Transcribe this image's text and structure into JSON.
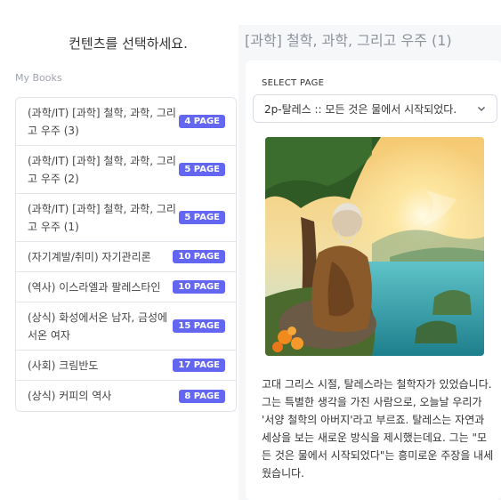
{
  "left": {
    "title": "컨텐츠를 선택하세요.",
    "section_label": "My Books",
    "books": [
      {
        "title": "(과학/IT) [과학] 철학, 과학, 그리고 우주 (3)",
        "pages": "4 PAGE"
      },
      {
        "title": "(과학/IT) [과학] 철학, 과학, 그리고 우주 (2)",
        "pages": "5 PAGE"
      },
      {
        "title": "(과학/IT) [과학] 철학, 과학, 그리고 우주 (1)",
        "pages": "5 PAGE"
      },
      {
        "title": "(자기계발/취미) 자기관리론",
        "pages": "10 PAGE"
      },
      {
        "title": "(역사) 이스라엘과 팔레스타인",
        "pages": "10 PAGE"
      },
      {
        "title": "(상식) 화성에서온 남자, 금성에서온 여자",
        "pages": "15 PAGE"
      },
      {
        "title": "(사회) 크림반도",
        "pages": "17 PAGE"
      },
      {
        "title": "(상식) 커피의 역사",
        "pages": "8 PAGE"
      }
    ]
  },
  "right": {
    "title": "[과학] 철학, 과학, 그리고 우주 (1)",
    "select_label": "SELECT PAGE",
    "select_value": "2p-탈레스 :: 모든 것은 물에서 시작되었다.",
    "description": "고대 그리스 시절, 탈레스라는 철학자가 있었습니다. 그는 특별한 생각을 가진 사람으로, 오늘날 우리가 '서양 철학의 아버지'라고 부르죠. 탈레스는 자연과 세상을 보는 새로운 방식을 제시했는데요. 그는 \"모든 것은 물에서 시작되었다\"는 흥미로운 주장을 내세웠습니다."
  },
  "colors": {
    "accent": "#6366f1",
    "panel_bg": "#f6f7f9"
  }
}
